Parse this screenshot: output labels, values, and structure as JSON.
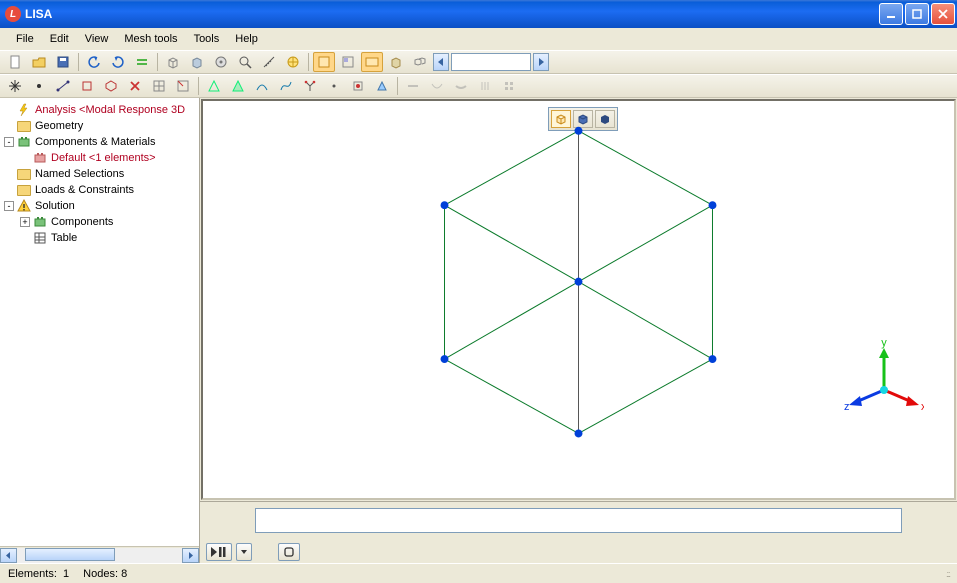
{
  "app": {
    "title": "LISA",
    "icon_letter": "L"
  },
  "menu": {
    "items": [
      "File",
      "Edit",
      "View",
      "Mesh tools",
      "Tools",
      "Help"
    ]
  },
  "tree": {
    "items": [
      {
        "level": 1,
        "icon": "bolt",
        "label": "Analysis <Modal Response 3D",
        "red": true,
        "expander": null
      },
      {
        "level": 1,
        "icon": "folder",
        "label": "Geometry",
        "red": false,
        "expander": null
      },
      {
        "level": 1,
        "icon": "comp",
        "label": "Components & Materials",
        "red": false,
        "expander": "-"
      },
      {
        "level": 2,
        "icon": "default",
        "label": "Default <1 elements>",
        "red": true,
        "expander": null
      },
      {
        "level": 1,
        "icon": "folder",
        "label": "Named Selections",
        "red": false,
        "expander": null
      },
      {
        "level": 1,
        "icon": "folder",
        "label": "Loads & Constraints",
        "red": false,
        "expander": null
      },
      {
        "level": 1,
        "icon": "warn",
        "label": "Solution",
        "red": false,
        "expander": "-"
      },
      {
        "level": 2,
        "icon": "comp",
        "label": "Components",
        "red": false,
        "expander": "+"
      },
      {
        "level": 2,
        "icon": "table",
        "label": "Table",
        "red": false,
        "expander": null
      }
    ]
  },
  "axes": {
    "x": "x",
    "y": "y",
    "z": "z"
  },
  "status": {
    "elements_label": "Elements:",
    "elements_value": "1",
    "nodes_label": "Nodes:",
    "nodes_value": "8"
  }
}
